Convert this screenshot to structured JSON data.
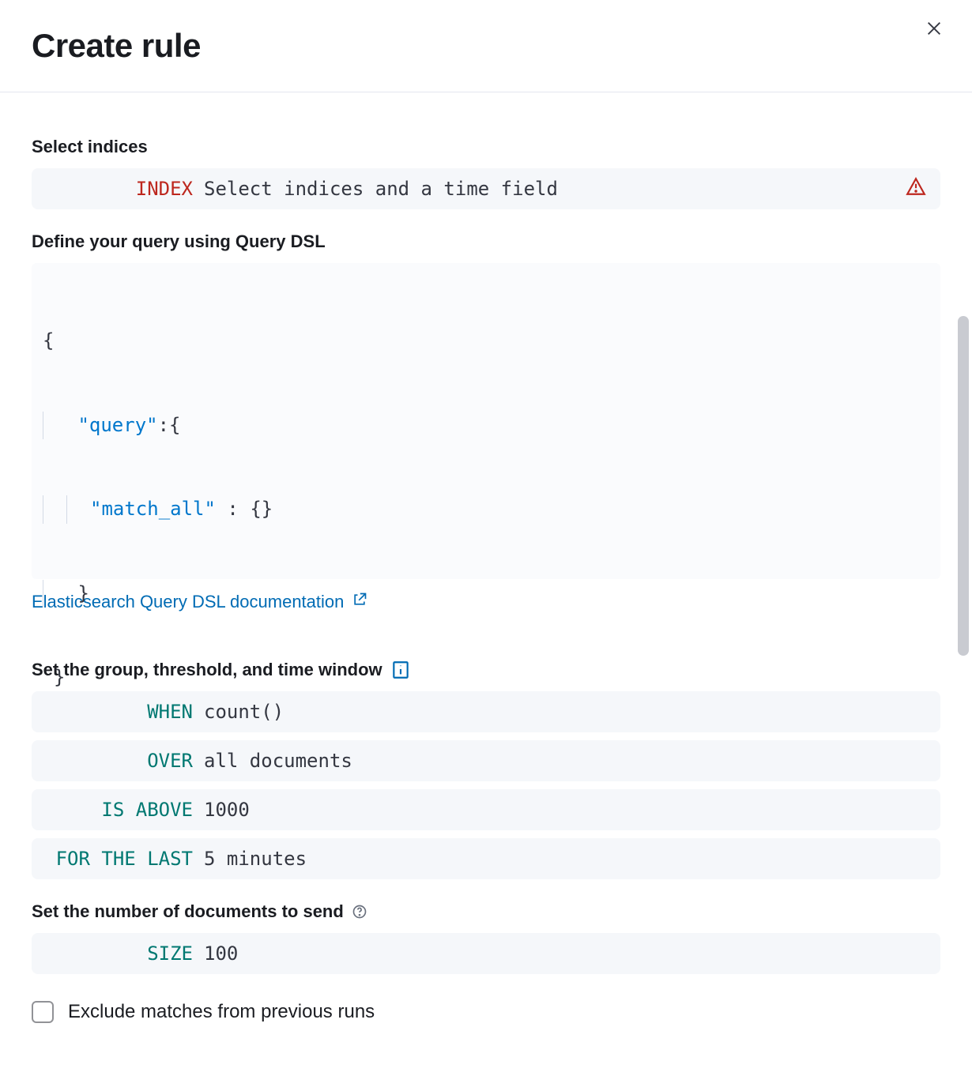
{
  "header": {
    "title": "Create rule"
  },
  "indices": {
    "label": "Select indices",
    "keyword": "INDEX",
    "placeholder": "Select indices and a time field"
  },
  "query": {
    "label": "Define your query using Query DSL",
    "code": {
      "key1": "\"query\"",
      "key2": "\"match_all\"",
      "punct_open": "{",
      "punct_colon_open": ":{",
      "punct_space_colon_space": " : ",
      "punct_empty_obj": "{}",
      "punct_close": "}"
    },
    "doc_link": "Elasticsearch Query DSL documentation"
  },
  "threshold": {
    "label": "Set the group, threshold, and time window",
    "rows": [
      {
        "keyword": "WHEN",
        "value": "count()"
      },
      {
        "keyword": "OVER",
        "value": "all documents"
      },
      {
        "keyword": "IS ABOVE",
        "value": "1000"
      },
      {
        "keyword": "FOR THE LAST",
        "value": "5 minutes"
      }
    ]
  },
  "size": {
    "label": "Set the number of documents to send",
    "keyword": "SIZE",
    "value": "100"
  },
  "exclude": {
    "label": "Exclude matches from previous runs",
    "checked": false
  }
}
